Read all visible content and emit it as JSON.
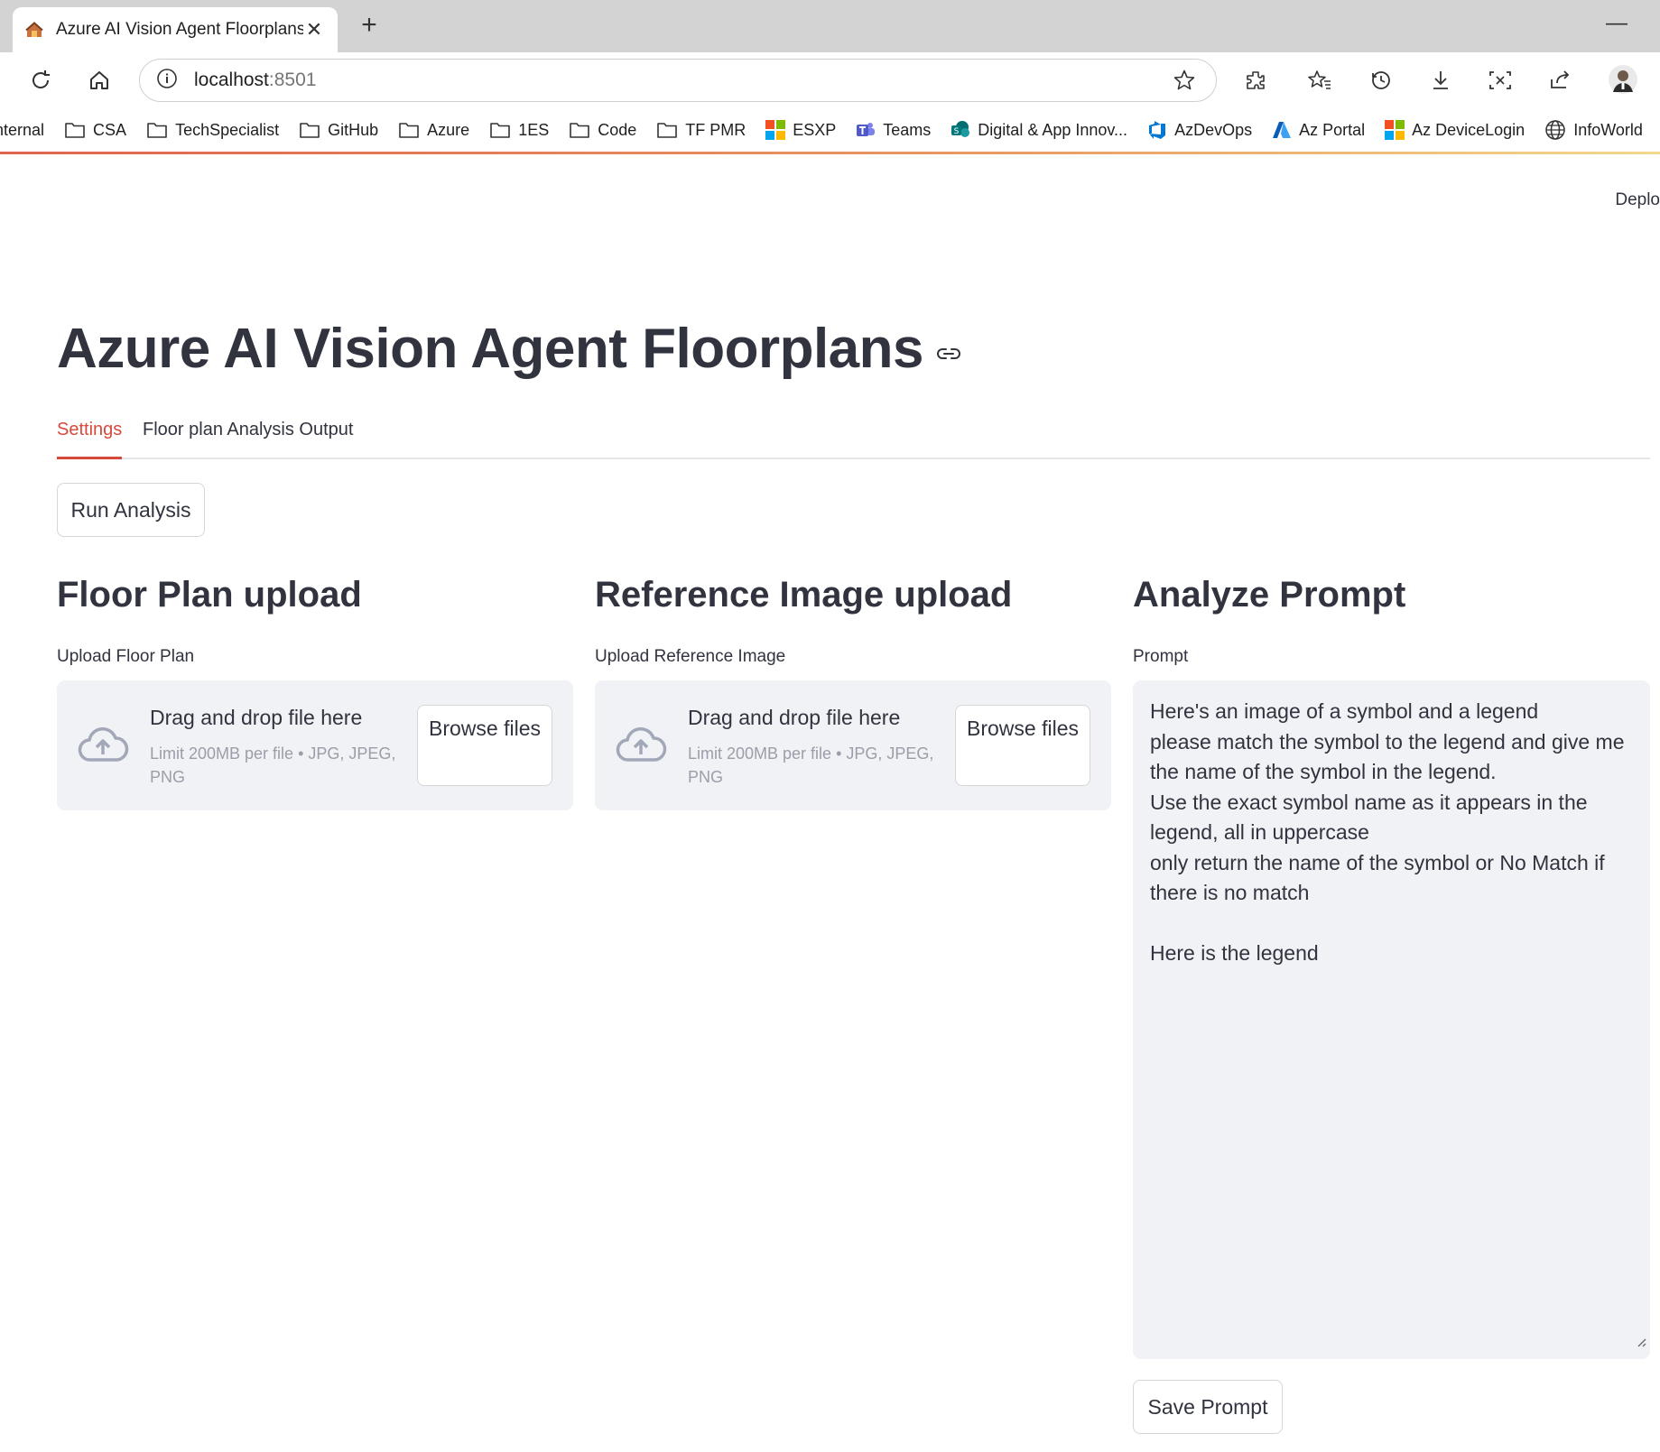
{
  "browser": {
    "tab_title": "Azure AI Vision Agent Floorplans",
    "tab_close": "✕",
    "new_tab": "+",
    "minimize": "—",
    "url_host": "localhost",
    "url_port": ":8501",
    "bookmarks": [
      {
        "label": "nternal",
        "icon": "folder-icon"
      },
      {
        "label": "CSA",
        "icon": "folder-icon"
      },
      {
        "label": "TechSpecialist",
        "icon": "folder-icon"
      },
      {
        "label": "GitHub",
        "icon": "folder-icon"
      },
      {
        "label": "Azure",
        "icon": "folder-icon"
      },
      {
        "label": "1ES",
        "icon": "folder-icon"
      },
      {
        "label": "Code",
        "icon": "folder-icon"
      },
      {
        "label": "TF PMR",
        "icon": "folder-icon"
      },
      {
        "label": "ESXP",
        "icon": "microsoft-logo-icon"
      },
      {
        "label": "Teams",
        "icon": "teams-icon"
      },
      {
        "label": "Digital & App Innov...",
        "icon": "sharepoint-icon"
      },
      {
        "label": "AzDevOps",
        "icon": "azure-devops-icon"
      },
      {
        "label": "Az Portal",
        "icon": "azure-icon"
      },
      {
        "label": "Az DeviceLogin",
        "icon": "microsoft-logo-icon"
      },
      {
        "label": "InfoWorld",
        "icon": "globe-icon"
      }
    ]
  },
  "app": {
    "deploy_label": "Deplo",
    "title": "Azure AI Vision Agent Floorplans",
    "tabs": [
      {
        "label": "Settings",
        "active": true
      },
      {
        "label": "Floor plan Analysis Output",
        "active": false
      }
    ],
    "run_button": "Run Analysis",
    "columns": {
      "floor_plan": {
        "title": "Floor Plan upload",
        "label": "Upload Floor Plan",
        "drop_text": "Drag and drop file here",
        "limit_text": "Limit 200MB per file • JPG, JPEG, PNG",
        "browse_label": "Browse files"
      },
      "reference": {
        "title": "Reference Image upload",
        "label": "Upload Reference Image",
        "drop_text": "Drag and drop file here",
        "limit_text": "Limit 200MB per file • JPG, JPEG, PNG",
        "browse_label": "Browse files"
      },
      "prompt": {
        "title": "Analyze Prompt",
        "label": "Prompt",
        "value": "Here's an image of a symbol and a legend\nplease match the symbol to the legend and give me the name of the symbol in the legend.\nUse the exact symbol name as it appears in the legend, all in uppercase\nonly return the name of the symbol or No Match if there is no match\n\nHere is the legend",
        "save_button": "Save Prompt"
      }
    }
  },
  "colors": {
    "accent": "#d64a3b",
    "text": "#31333f",
    "muted": "#9c9da8",
    "panel": "#f0f2f6"
  }
}
